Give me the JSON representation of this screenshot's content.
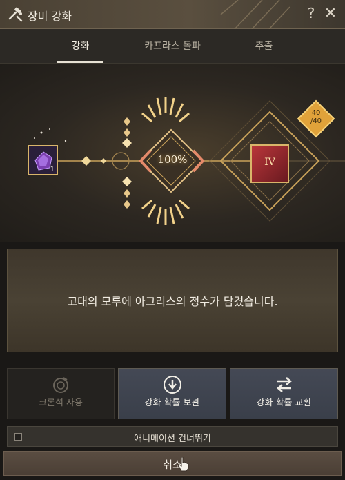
{
  "window": {
    "title": "장비 강화",
    "help_label": "?",
    "close_label": "✕"
  },
  "tabs": [
    {
      "label": "강화",
      "active": true
    },
    {
      "label": "카프라스 돌파",
      "active": false
    },
    {
      "label": "추출",
      "active": false
    }
  ],
  "stage": {
    "material_count": "1",
    "success_rate": "100%",
    "result_tier": "IV",
    "counter_current": "40",
    "counter_max": "/40"
  },
  "message": "고대의 모루에 아그리스의 정수가 담겼습니다.",
  "buttons": {
    "chronos": "크론석 사용",
    "keep_rate": "강화 확률 보관",
    "swap_rate": "강화 확률 교환"
  },
  "skip_animation": "애니메이션 건너뛰기",
  "cancel": "취소",
  "colors": {
    "accent_gold": "#d9b56a",
    "button_blue": "#3f4450",
    "result_red": "#b9363a"
  }
}
